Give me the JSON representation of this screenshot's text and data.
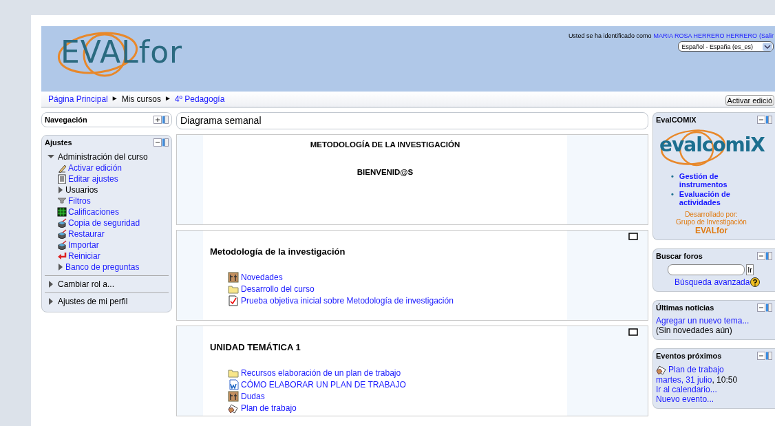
{
  "header": {
    "logo": "EVALfor",
    "login_text": "Usted se ha identificado como",
    "user": "MARIA ROSA HERRERO HERRERO",
    "logout": "(Salir",
    "language": "Español - España (es_es)"
  },
  "breadcrumb": {
    "separator": "►",
    "items": [
      {
        "label": "Página Principal",
        "link": true
      },
      {
        "label": "Mis cursos",
        "link": false
      },
      {
        "label": "4º Pedagogía",
        "link": true
      }
    ]
  },
  "edit_button": "Activar edició",
  "left_blocks": [
    {
      "title": "Navegación",
      "collapsed": true
    },
    {
      "title": "Ajustes",
      "collapsed": false,
      "tree": [
        {
          "label": "Administración del curso",
          "kind": "branch",
          "link": false,
          "expanded": true,
          "children": [
            {
              "label": "Activar edición",
              "kind": "pen",
              "link": true
            },
            {
              "label": "Editar ajustes",
              "kind": "document",
              "link": true
            },
            {
              "label": "Usuarios",
              "kind": "branch",
              "link": false,
              "expanded": false
            },
            {
              "label": "Filtros",
              "kind": "funnel",
              "link": true
            },
            {
              "label": "Calificaciones",
              "kind": "grid",
              "link": true
            },
            {
              "label": "Copia de seguridad",
              "kind": "box",
              "link": true
            },
            {
              "label": "Restaurar",
              "kind": "box",
              "link": true
            },
            {
              "label": "Importar",
              "kind": "box",
              "link": true
            },
            {
              "label": "Reiniciar",
              "kind": "return",
              "link": true
            },
            {
              "label": "Banco de preguntas",
              "kind": "branch",
              "link": true,
              "expanded": false
            }
          ]
        },
        {
          "label": "Cambiar rol a...",
          "kind": "branch",
          "link": false,
          "expanded": false
        },
        {
          "label": "Ajustes de mi perfil",
          "kind": "branch",
          "link": false,
          "expanded": false
        }
      ]
    }
  ],
  "course": {
    "heading": "Diagrama semanal",
    "sections": [
      {
        "kind": "summary",
        "lines": [
          "METODOLOGÍA DE LA INVESTIGACIÓN",
          "BIENVENID@S"
        ]
      },
      {
        "kind": "week",
        "title": "Metodología de la investigación",
        "activities": [
          {
            "label": "Novedades",
            "kind": "people"
          },
          {
            "label": "Desarrollo del curso",
            "kind": "folder"
          },
          {
            "label": "Prueba objetiva inicial sobre Metodología de investigación",
            "kind": "check"
          }
        ]
      },
      {
        "kind": "week",
        "title": "UNIDAD TEMÁTICA 1",
        "activities": [
          {
            "label": "Recursos elaboración de un plan de trabajo",
            "kind": "folder"
          },
          {
            "label": "CÓMO ELABORAR UN PLAN DE TRABAJO",
            "kind": "word"
          },
          {
            "label": "Dudas",
            "kind": "people"
          },
          {
            "label": "Plan de trabajo",
            "kind": "hand"
          }
        ]
      }
    ]
  },
  "right_blocks": [
    {
      "kind": "evalcomix",
      "title": "EvalCOMIX",
      "collapsed": false,
      "logo": "evalcomiX",
      "bullet": "•",
      "links": [
        "Gestión de instrumentos",
        "Evaluación de actividades"
      ],
      "credit": [
        "Desarrollado por:",
        "Grupo de Investigación"
      ],
      "credit_name": "EVALfor"
    },
    {
      "kind": "search",
      "title": "Buscar foros",
      "collapsed": false,
      "button": "Ir",
      "advanced": "Búsqueda avanzada"
    },
    {
      "kind": "news",
      "title": "Últimas noticias",
      "collapsed": false,
      "link": "Agregar un nuevo tema...",
      "note": "(Sin novedades aún)"
    },
    {
      "kind": "events",
      "title": "Eventos próximos",
      "collapsed": false,
      "event": "Plan de trabajo",
      "date": "martes, 31 julio",
      "time": ", 10:50",
      "links": [
        "Ir al calendario...",
        "Nuevo evento..."
      ]
    }
  ]
}
